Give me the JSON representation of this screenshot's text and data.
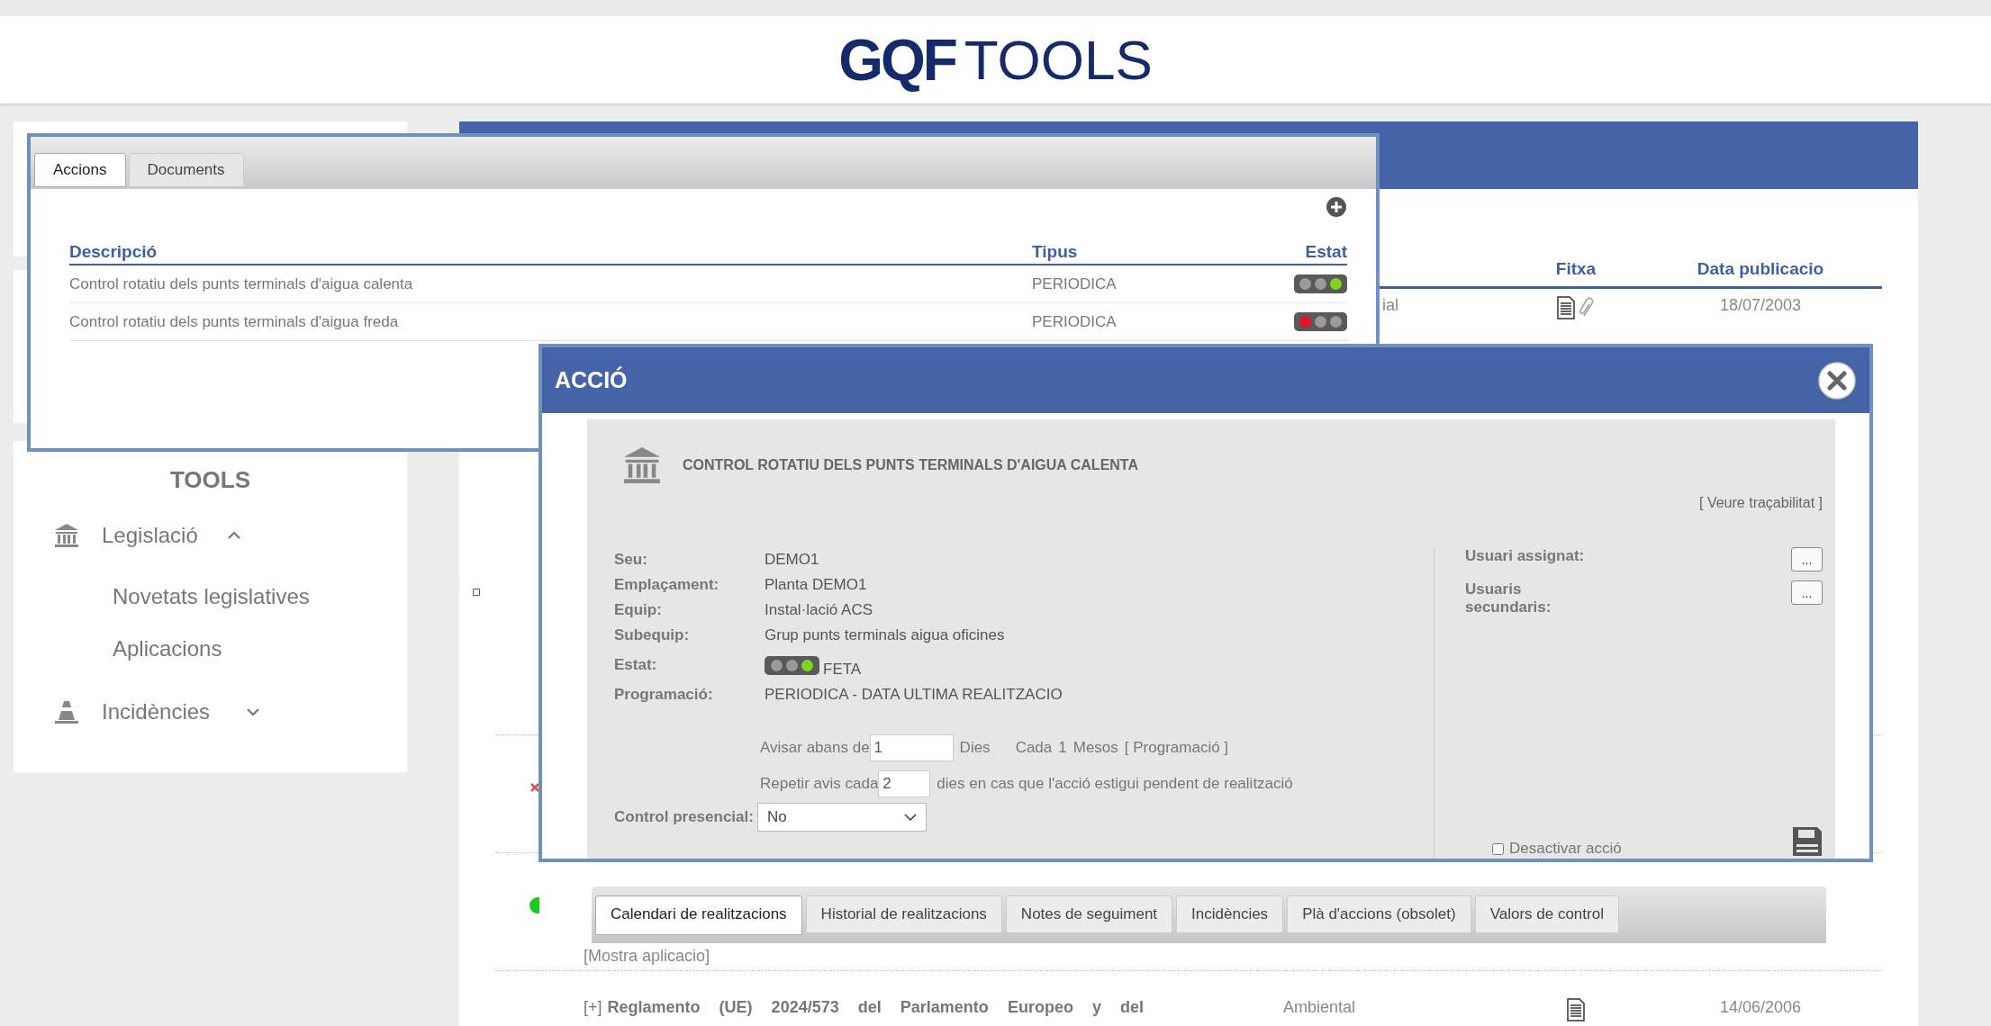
{
  "header": {
    "logo_mark": "GQF",
    "logo_text": "TOOLS"
  },
  "sidebar": {
    "title": "TOOLS",
    "items": [
      {
        "label": "Legislació",
        "kind": "bank",
        "expanded": true,
        "children": [
          {
            "label": "Novetats legislatives"
          },
          {
            "label": "Aplicacions"
          }
        ]
      },
      {
        "label": "Incidències",
        "kind": "cone",
        "expanded": false
      }
    ]
  },
  "main_table": {
    "columns": [
      {
        "label": "Fitxa"
      },
      {
        "label": "Data publicacio"
      }
    ],
    "rows": [
      {
        "kind": "square",
        "category": "ial",
        "document": true,
        "attachment": true,
        "date": "18/07/2003"
      },
      {
        "kind": "cross"
      },
      {
        "kind": "dot",
        "link": "[Mostra aplicacio]"
      },
      {
        "expander": "[+]",
        "title": "Reglamento (UE) 2024/573 del Parlamento Europeo y del",
        "category": "Ambiental",
        "document": true,
        "attachment": false,
        "date": "14/06/2006"
      }
    ]
  },
  "actions_popup": {
    "tabs": [
      {
        "label": "Accions",
        "selected": true
      },
      {
        "label": "Documents",
        "selected": false
      }
    ],
    "columns": [
      "Descripció",
      "Tipus",
      "Estat"
    ],
    "rows": [
      {
        "description": "Control rotatiu dels punts terminals d'aigua calenta",
        "type": "PERIODICA",
        "lights": [
          {
            "on": false
          },
          {
            "on": false
          },
          {
            "on": true
          }
        ]
      },
      {
        "description": "Control rotatiu dels punts terminals d'aigua freda",
        "type": "PERIODICA",
        "lights": [
          {
            "on": true
          },
          {
            "on": false
          },
          {
            "on": false
          }
        ]
      }
    ]
  },
  "action_dialog": {
    "title": "ACCIÓ",
    "heading": "CONTROL ROTATIU DELS PUNTS TERMINALS D'AIGUA CALENTA",
    "trace_link": "[ Veure traçabilitat ]",
    "fields": [
      {
        "kind": "text",
        "label": "Seu:",
        "value": "DEMO1"
      },
      {
        "kind": "text",
        "label": "Emplaçament:",
        "value": "Planta DEMO1"
      },
      {
        "kind": "text",
        "label": "Equip:",
        "value": "Instal·lació ACS"
      },
      {
        "kind": "text",
        "label": "Subequip:",
        "value": "Grup punts terminals aigua oficines"
      },
      {
        "kind": "light",
        "label": "Estat:",
        "lights": [
          {
            "on": false
          },
          {
            "on": false
          },
          {
            "on": true
          }
        ],
        "value": "FETA"
      },
      {
        "kind": "text",
        "label": "Programació:",
        "value": "PERIODICA - DATA ULTIMA REALITZACIO"
      }
    ],
    "notice": {
      "warn_before": "Avisar abans de",
      "warn_value": "1",
      "days": "Dies",
      "every": "Cada",
      "every_value": "1",
      "months": "Mesos",
      "program_link": "[ Programació ]",
      "repeat": "Repetir avis cada",
      "repeat_value": "2",
      "repeat_suffix": "dies en cas que l'acció estigui pendent de realització"
    },
    "presencial": {
      "label": "Control presencial:",
      "value": "No"
    },
    "users": [
      {
        "label": "Usuari assignat:",
        "button": "..."
      },
      {
        "label": "Usuaris secundaris:",
        "button": "..."
      }
    ],
    "deactivate": {
      "label": "Desactivar acció",
      "checked": false
    }
  },
  "tabs_bar": {
    "tabs": [
      {
        "label": "Calendari de realitzacions",
        "selected": true
      },
      {
        "label": "Historial de realitzacions",
        "selected": false
      },
      {
        "label": "Notes de seguiment",
        "selected": false
      },
      {
        "label": "Incidències",
        "selected": false
      },
      {
        "label": "Plà d'accions (obsolet)",
        "selected": false
      },
      {
        "label": "Valors de control",
        "selected": false
      }
    ]
  }
}
